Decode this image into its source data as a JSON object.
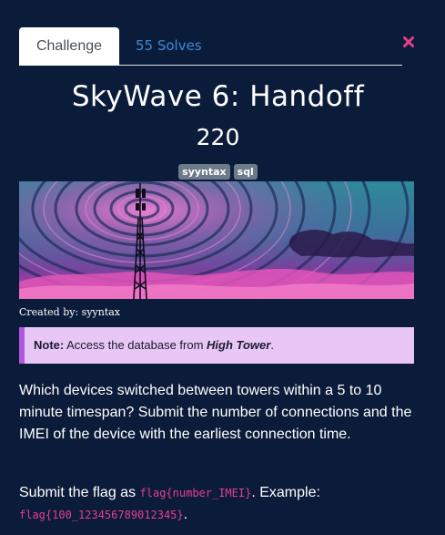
{
  "tabs": {
    "challenge": "Challenge",
    "solves": "55 Solves"
  },
  "challenge": {
    "title": "SkyWave 6: Handoff",
    "points": "220",
    "tags": [
      "syyntax",
      "sql"
    ],
    "created_by": "Created by: syyntax"
  },
  "note": {
    "label": "Note:",
    "text_before": " Access the database from ",
    "emphasis": "High Tower",
    "text_after": "."
  },
  "description": "Which devices switched between towers within a 5 to 10 minute timespan? Submit the number of connections and the IMEI of the device with the earliest connection time.",
  "flag_instructions": {
    "prefix": "Submit the flag as ",
    "format": "flag{number_IMEI}",
    "middle": ". Example:",
    "example": "flag{100_123456789012345}",
    "suffix": "."
  },
  "colors": {
    "background": "#0b1c3a",
    "tab_active_bg": "#ffffff",
    "tab_link": "#3f87d6",
    "tag_bg": "#6c7a89",
    "note_bg": "#e8c6f5",
    "note_border": "#b057e0",
    "code": "#e83e8c",
    "close": "#e83e8c"
  },
  "icons": {
    "close": "close-icon",
    "banner": "radio-tower-image"
  }
}
